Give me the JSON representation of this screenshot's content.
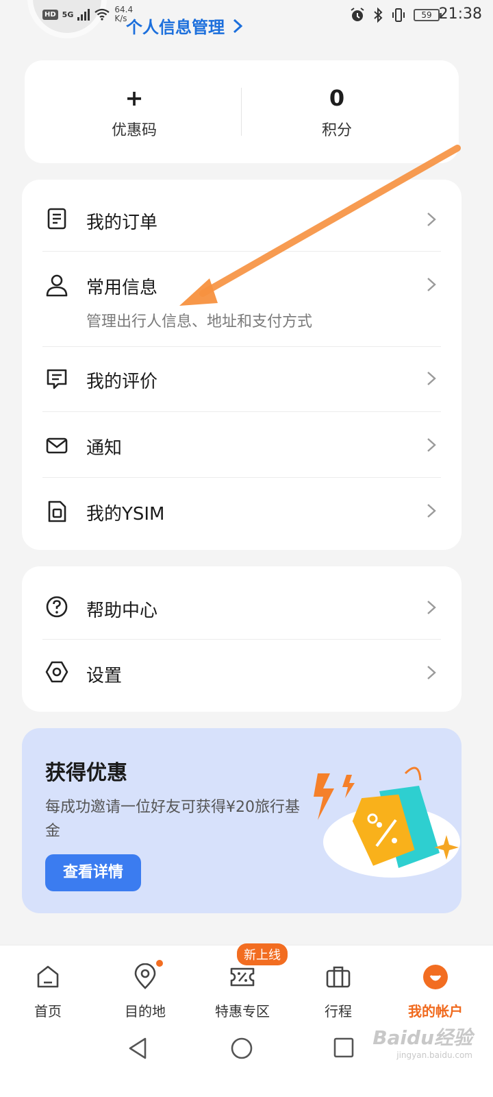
{
  "status_bar": {
    "hd": "HD",
    "network": "5G",
    "speed_value": "64.4",
    "speed_unit": "K/s",
    "battery": "59",
    "time": "21:38"
  },
  "profile_link": "个人信息管理",
  "points": {
    "coupon_value": "+",
    "coupon_label": "优惠码",
    "score_value": "0",
    "score_label": "积分"
  },
  "menu1": [
    {
      "icon": "order-icon",
      "title": "我的订单"
    },
    {
      "icon": "person-icon",
      "title": "常用信息",
      "sub": "管理出行人信息、地址和支付方式"
    },
    {
      "icon": "review-icon",
      "title": "我的评价"
    },
    {
      "icon": "mail-icon",
      "title": "通知"
    },
    {
      "icon": "sim-icon",
      "title": "我的YSIM"
    }
  ],
  "menu2": [
    {
      "icon": "help-icon",
      "title": "帮助中心"
    },
    {
      "icon": "settings-icon",
      "title": "设置"
    }
  ],
  "promo": {
    "title": "获得优惠",
    "desc": "每成功邀请一位好友可获得¥20旅行基金",
    "button": "查看详情"
  },
  "nav": {
    "tabs": [
      "首页",
      "目的地",
      "特惠专区",
      "行程",
      "我的帐户"
    ],
    "badge": "新上线",
    "active_index": 4
  },
  "watermark": {
    "main": "Baidu经验",
    "sub": "jingyan.baidu.com"
  },
  "colors": {
    "accent": "#f06a1e",
    "link": "#1c6fdc",
    "button": "#3b7cf0",
    "promo_bg": "#d7e1fb"
  }
}
